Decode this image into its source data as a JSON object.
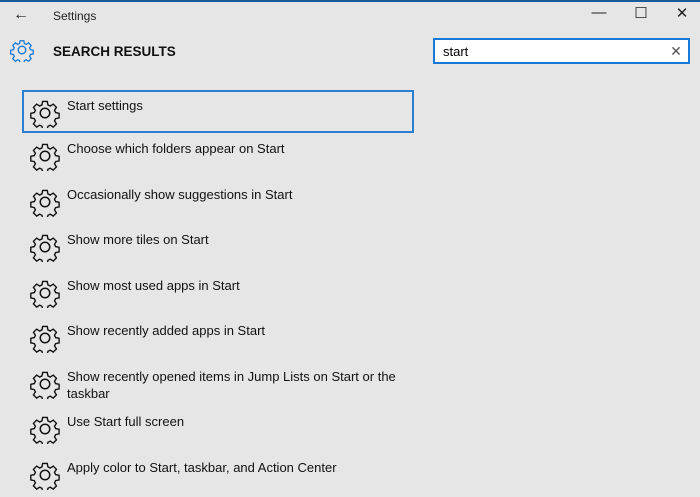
{
  "window": {
    "title": "Settings",
    "back": "←",
    "minimize": "—",
    "maximize": "☐",
    "close": "✕"
  },
  "header": {
    "title": "SEARCH RESULTS",
    "icon": "gear-icon",
    "accent": "#1979d4"
  },
  "search": {
    "value": "start",
    "clear": "✕"
  },
  "results": [
    {
      "label": "Start settings",
      "selected": true
    },
    {
      "label": "Choose which folders appear on Start"
    },
    {
      "label": "Occasionally show suggestions in Start"
    },
    {
      "label": "Show more tiles on Start"
    },
    {
      "label": "Show most used apps in Start"
    },
    {
      "label": "Show recently added apps in Start"
    },
    {
      "label": "Show recently opened items in Jump Lists on Start or the taskbar"
    },
    {
      "label": "Use Start full screen"
    },
    {
      "label": "Apply color to Start, taskbar, and Action Center"
    }
  ]
}
